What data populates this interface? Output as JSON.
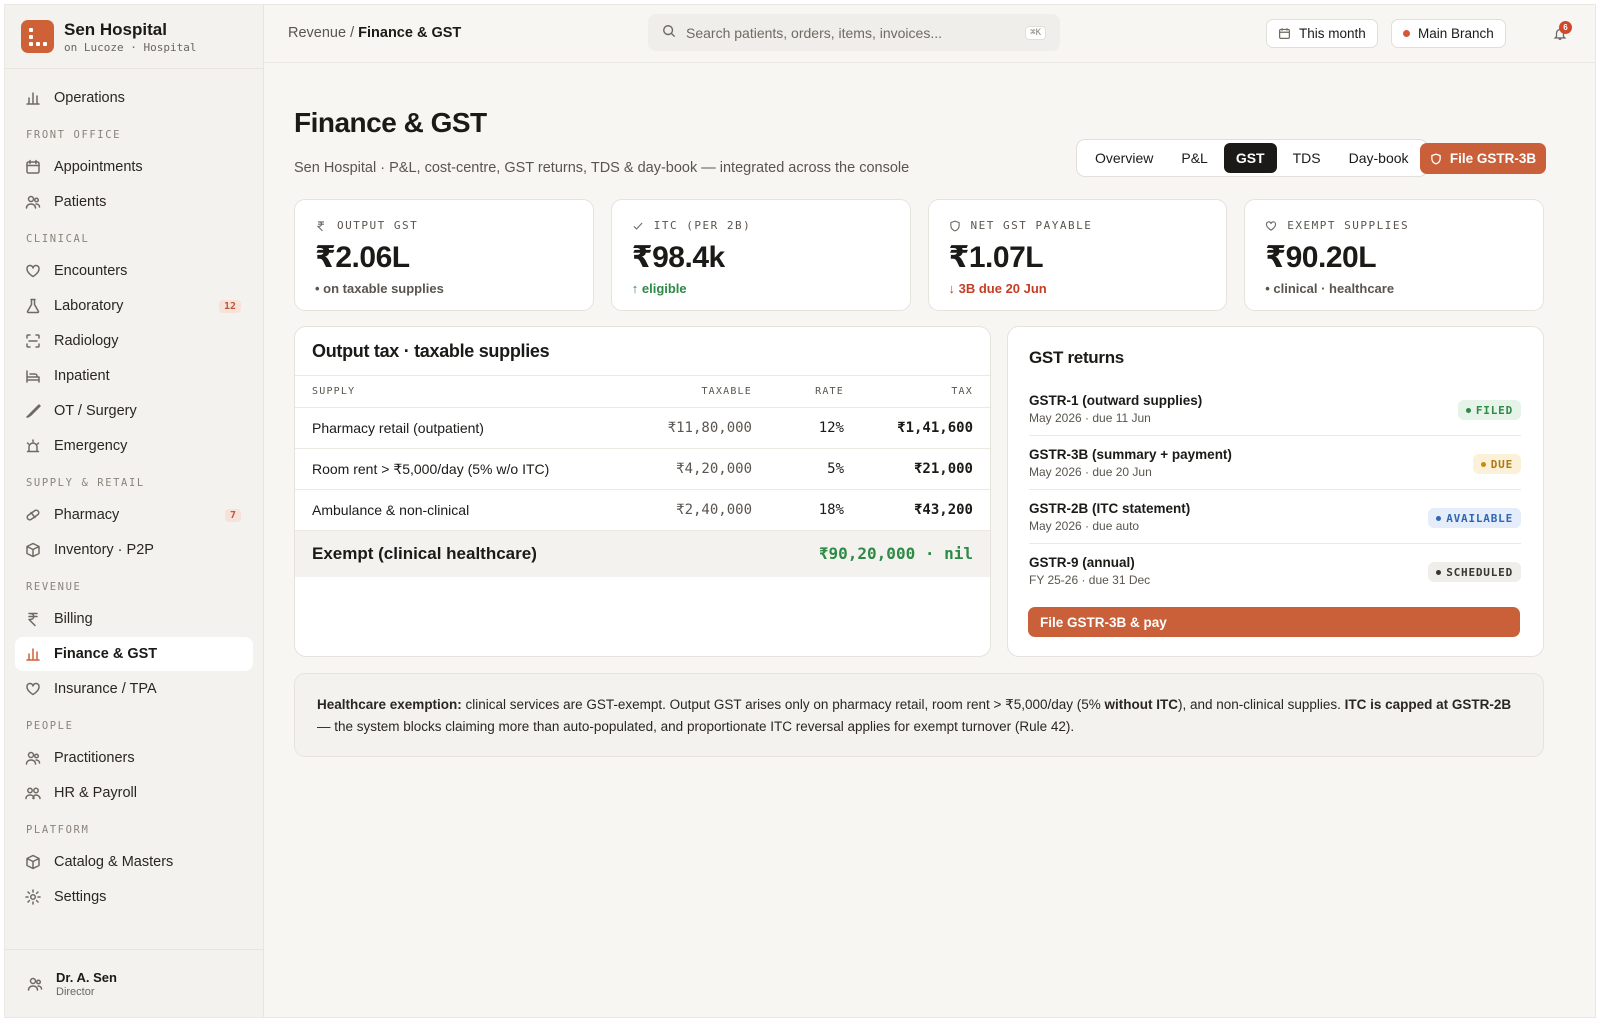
{
  "brand": {
    "name": "Sen Hospital",
    "sub": "on Lucoze · Hospital"
  },
  "nav": {
    "operations": "Operations",
    "front_office": {
      "title": "FRONT OFFICE",
      "appointments": "Appointments",
      "patients": "Patients"
    },
    "clinical": {
      "title": "CLINICAL",
      "encounters": "Encounters",
      "laboratory": "Laboratory",
      "laboratory_badge": "12",
      "radiology": "Radiology",
      "inpatient": "Inpatient",
      "ot_surgery": "OT / Surgery",
      "emergency": "Emergency"
    },
    "supply": {
      "title": "SUPPLY & RETAIL",
      "pharmacy": "Pharmacy",
      "pharmacy_badge": "7",
      "inventory": "Inventory · P2P"
    },
    "revenue": {
      "title": "REVENUE",
      "billing": "Billing",
      "finance": "Finance & GST",
      "insurance": "Insurance / TPA"
    },
    "people": {
      "title": "PEOPLE",
      "practitioners": "Practitioners",
      "hr": "HR & Payroll"
    },
    "platform": {
      "title": "PLATFORM",
      "catalog": "Catalog & Masters",
      "settings": "Settings"
    }
  },
  "user": {
    "name": "Dr. A. Sen",
    "role": "Director"
  },
  "topbar": {
    "breadcrumb_parent": "Revenue",
    "breadcrumb_sep": " / ",
    "breadcrumb_current": "Finance & GST",
    "search_placeholder": "Search patients, orders, items, invoices...",
    "search_shortcut": "⌘K",
    "period": "This month",
    "branch": "Main Branch",
    "notifications": "6"
  },
  "page": {
    "title": "Finance & GST",
    "subtitle": "Sen Hospital · P&L, cost-centre, GST returns, TDS & day-book — integrated across the console"
  },
  "tabs": [
    "Overview",
    "P&L",
    "GST",
    "TDS",
    "Day-book"
  ],
  "active_tab": "GST",
  "file_button": "File GSTR-3B",
  "kpis": [
    {
      "label": "OUTPUT GST",
      "value": "₹2.06L",
      "note": "• on taxable supplies"
    },
    {
      "label": "ITC (PER 2B)",
      "value": "₹98.4k",
      "note": "↑ eligible"
    },
    {
      "label": "NET GST PAYABLE",
      "value": "₹1.07L",
      "note": "↓ 3B due 20 Jun"
    },
    {
      "label": "EXEMPT SUPPLIES",
      "value": "₹90.20L",
      "note": "• clinical · healthcare"
    }
  ],
  "output_tax": {
    "title": "Output tax · taxable supplies",
    "columns": [
      "SUPPLY",
      "TAXABLE",
      "RATE",
      "TAX"
    ],
    "rows": [
      {
        "supply": "Pharmacy retail (outpatient)",
        "taxable": "₹11,80,000",
        "rate": "12%",
        "tax": "₹1,41,600"
      },
      {
        "supply": "Room rent > ₹5,000/day (5% w/o ITC)",
        "taxable": "₹4,20,000",
        "rate": "5%",
        "tax": "₹21,000"
      },
      {
        "supply": "Ambulance & non-clinical",
        "taxable": "₹2,40,000",
        "rate": "18%",
        "tax": "₹43,200"
      }
    ],
    "exempt_label": "Exempt (clinical healthcare)",
    "exempt_value": "₹90,20,000 · nil"
  },
  "gst_returns": {
    "title": "GST returns",
    "items": [
      {
        "name": "GSTR-1 (outward supplies)",
        "sub": "May 2026 · due 11 Jun",
        "status": "FILED"
      },
      {
        "name": "GSTR-3B (summary + payment)",
        "sub": "May 2026 · due 20 Jun",
        "status": "DUE"
      },
      {
        "name": "GSTR-2B (ITC statement)",
        "sub": "May 2026 · due auto",
        "status": "AVAILABLE"
      },
      {
        "name": "GSTR-9 (annual)",
        "sub": "FY 25-26 · due 31 Dec",
        "status": "SCHEDULED"
      }
    ],
    "pay_button": "File GSTR-3B & pay"
  },
  "note": {
    "lead": "Healthcare exemption:",
    "t1": " clinical services are GST-exempt. Output GST arises only on pharmacy retail, room rent > ₹5,000/day (5% ",
    "b1": "without ITC",
    "t2": "), and non-clinical supplies. ",
    "b2": "ITC is capped at GSTR-2B",
    "t3": " — the system blocks claiming more than auto-populated, and proportionate ITC reversal applies for exempt turnover (Rule 42)."
  },
  "colors": {
    "accent": "#c9603a",
    "filed": "#2e8a47",
    "due": "#b07a12",
    "available": "#2f67b5",
    "scheduled": "#4a4640"
  }
}
